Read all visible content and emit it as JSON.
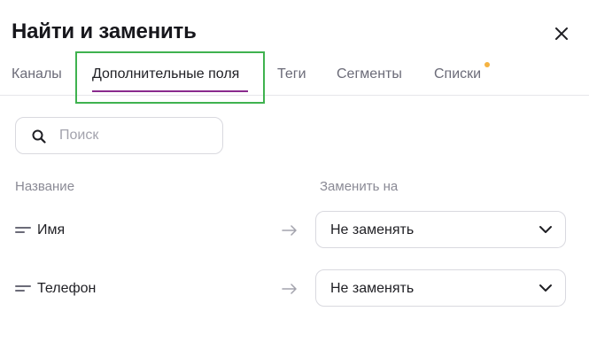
{
  "dialog": {
    "title": "Найти и заменить"
  },
  "tabs": [
    {
      "label": "Каналы"
    },
    {
      "label": "Дополнительные поля"
    },
    {
      "label": "Теги"
    },
    {
      "label": "Сегменты"
    },
    {
      "label": "Списки"
    }
  ],
  "active_tab": "Дополнительные поля",
  "search": {
    "placeholder": "Поиск",
    "value": ""
  },
  "columns": {
    "name": "Название",
    "replace_with": "Заменить на"
  },
  "rows": [
    {
      "name": "Имя",
      "replacement": "Не заменять"
    },
    {
      "name": "Телефон",
      "replacement": "Не заменять"
    }
  ],
  "colors": {
    "accent": "#8a2a8e",
    "highlight": "#3fb24f",
    "notification_dot": "#f5b342"
  },
  "icons": {
    "close": "close-icon",
    "search": "search-icon",
    "field": "field-icon",
    "arrow": "arrow-right-icon",
    "dropdown": "chevron-down-icon"
  }
}
